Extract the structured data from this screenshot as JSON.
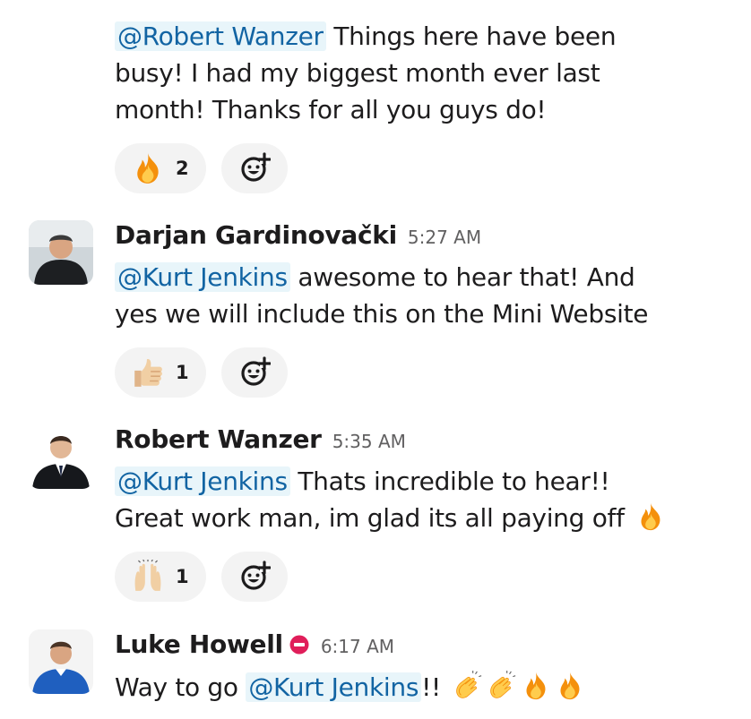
{
  "messages": [
    {
      "lines": [
        {
          "mention": "@Robert Wanzer",
          "text": " Things here have been"
        },
        {
          "text": "busy! I had my biggest month ever last"
        },
        {
          "text": "month! Thanks for all you guys do!"
        }
      ],
      "reaction": {
        "emoji": "fire-icon",
        "count": "2"
      }
    },
    {
      "author": "Darjan Gardinovački",
      "time": "5:27 AM",
      "lines": [
        {
          "mention": "@Kurt Jenkins",
          "text": " awesome to hear that! And"
        },
        {
          "text": "yes we will include this on the Mini Website"
        }
      ],
      "reaction": {
        "emoji": "thumbs-up-icon",
        "count": "1"
      }
    },
    {
      "author": "Robert Wanzer",
      "time": "5:35 AM",
      "lines": [
        {
          "mention": "@Kurt Jenkins",
          "text": " Thats incredible to hear!!"
        },
        {
          "text": "Great work man, im glad its all paying off "
        }
      ],
      "reaction": {
        "emoji": "raised-hands-icon",
        "count": "1"
      }
    },
    {
      "author": "Luke Howell",
      "time": "6:17 AM",
      "status": "do-not-disturb-icon",
      "lines": [
        {
          "text": "Way to go ",
          "mention": "@Kurt Jenkins",
          "after": "!! "
        }
      ]
    }
  ],
  "colors": {
    "mention_bg": "#e8f5fa",
    "mention_text": "#1264a3",
    "reaction_bg": "#f3f3f3",
    "timestamp": "#616061"
  }
}
